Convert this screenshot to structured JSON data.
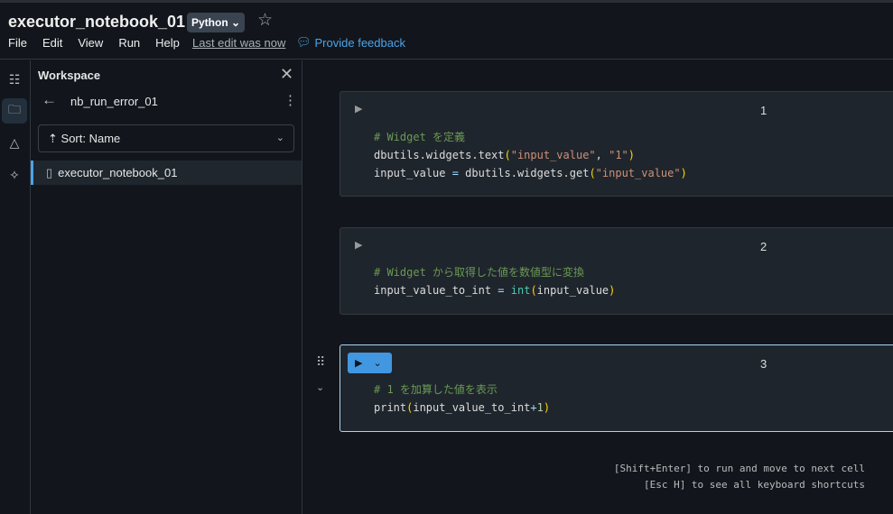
{
  "header": {
    "title": "executor_notebook_01",
    "language": "Python",
    "menu": [
      "File",
      "Edit",
      "View",
      "Run",
      "Help"
    ],
    "last_edit": "Last edit was now",
    "feedback": "Provide feedback"
  },
  "sidebar": {
    "title": "Workspace",
    "folder": "nb_run_error_01",
    "sort": "Sort: Name",
    "files": [
      "executor_notebook_01"
    ]
  },
  "cells": [
    {
      "number": "1",
      "lines": [
        [
          {
            "c": "t-comment",
            "t": "# Widget を定義"
          }
        ],
        [
          {
            "c": "",
            "t": "dbutils.widgets.text"
          },
          {
            "c": "t-paren",
            "t": "("
          },
          {
            "c": "t-str",
            "t": "\"input_value\""
          },
          {
            "c": "",
            "t": ", "
          },
          {
            "c": "t-str",
            "t": "\"1\""
          },
          {
            "c": "t-paren",
            "t": ")"
          }
        ],
        [
          {
            "c": "",
            "t": "input_value "
          },
          {
            "c": "t-op",
            "t": "="
          },
          {
            "c": "",
            "t": " dbutils.widgets.get"
          },
          {
            "c": "t-paren",
            "t": "("
          },
          {
            "c": "t-str",
            "t": "\"input_value\""
          },
          {
            "c": "t-paren",
            "t": ")"
          }
        ]
      ]
    },
    {
      "number": "2",
      "lines": [
        [
          {
            "c": "t-comment",
            "t": "# Widget から取得した値を数値型に変換"
          }
        ],
        [
          {
            "c": "",
            "t": "input_value_to_int "
          },
          {
            "c": "t-op",
            "t": "="
          },
          {
            "c": "",
            "t": " "
          },
          {
            "c": "t-builtin",
            "t": "int"
          },
          {
            "c": "t-paren",
            "t": "("
          },
          {
            "c": "",
            "t": "input_value"
          },
          {
            "c": "t-paren",
            "t": ")"
          }
        ]
      ]
    },
    {
      "number": "3",
      "lines": [
        [
          {
            "c": "t-comment",
            "t": "# 1 を加算した値を表示"
          }
        ],
        [
          {
            "c": "",
            "t": "print"
          },
          {
            "c": "t-paren",
            "t": "("
          },
          {
            "c": "",
            "t": "input_value_to_int"
          },
          {
            "c": "t-op",
            "t": "+"
          },
          {
            "c": "t-num",
            "t": "1"
          },
          {
            "c": "t-paren",
            "t": ")"
          }
        ]
      ]
    }
  ],
  "hints": [
    "[Shift+Enter] to run and move to next cell",
    "[Esc H] to see all keyboard shortcuts"
  ]
}
